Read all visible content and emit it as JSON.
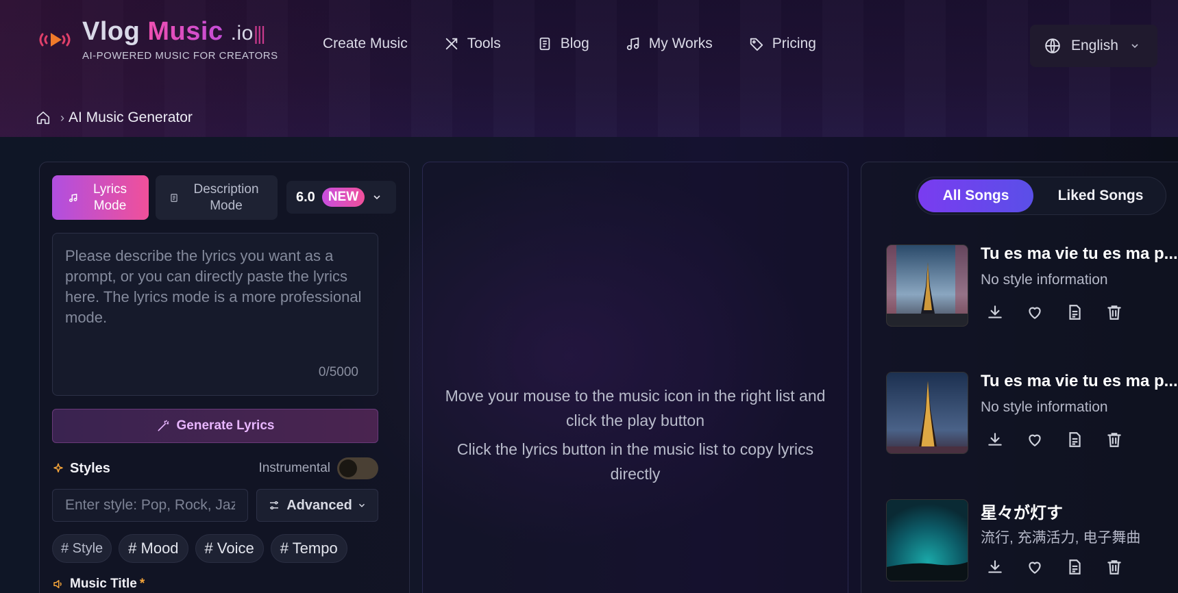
{
  "brand": {
    "name_part1": "Vlog",
    "name_part2": "Music",
    "name_suffix": ".io",
    "name_bars": "|||",
    "tagline": "AI-POWERED MUSIC FOR CREATORS"
  },
  "nav": {
    "items": [
      {
        "label": "Create Music",
        "icon": "none"
      },
      {
        "label": "Tools",
        "icon": "tools-icon"
      },
      {
        "label": "Blog",
        "icon": "document-icon"
      },
      {
        "label": "My Works",
        "icon": "music-note-icon"
      },
      {
        "label": "Pricing",
        "icon": "price-tag-icon"
      }
    ]
  },
  "language": {
    "label": "English",
    "icon": "globe-icon"
  },
  "breadcrumb": {
    "current": "AI Music Generator"
  },
  "create": {
    "modes": [
      {
        "label": "Lyrics Mode",
        "active": true
      },
      {
        "label": "Description Mode",
        "active": false
      }
    ],
    "version": {
      "number": "6.0",
      "badge": "NEW"
    },
    "lyrics": {
      "placeholder": "Please describe the lyrics you want as a prompt, or you can directly paste the lyrics here. The lyrics mode is a more professional mode.",
      "counter": "0/5000"
    },
    "generate_lyrics_label": "Generate Lyrics",
    "styles_label": "Styles",
    "instrumental_label": "Instrumental",
    "instrumental_on": false,
    "style_placeholder": "Enter style: Pop, Rock, Jazz",
    "advanced_label": "Advanced",
    "chips": [
      "# Style",
      "# Mood",
      "# Voice",
      "# Tempo"
    ],
    "music_title_label": "Music Title",
    "required_mark": "*"
  },
  "player_hint": {
    "line1": "Move your mouse to the music icon in the right list and click the play button",
    "line2": "Click the lyrics button in the music list to copy lyrics directly"
  },
  "song_list": {
    "tabs": [
      "All Songs",
      "Liked Songs"
    ],
    "active_tab": "All Songs",
    "songs": [
      {
        "title": "Tu es ma vie tu es ma p...",
        "style": "No style information"
      },
      {
        "title": "Tu es ma vie tu es ma p...",
        "style": "No style information"
      },
      {
        "title": "星々が灯す",
        "style": "流行, 充满活力, 电子舞曲"
      }
    ],
    "actions": [
      "download-icon",
      "heart-icon",
      "lyrics-icon",
      "trash-icon"
    ]
  },
  "colors": {
    "accent_pink": "#f0509a",
    "accent_purple": "#b04fe0",
    "tab_active": "#6a44ec",
    "required": "#f6a53a"
  }
}
